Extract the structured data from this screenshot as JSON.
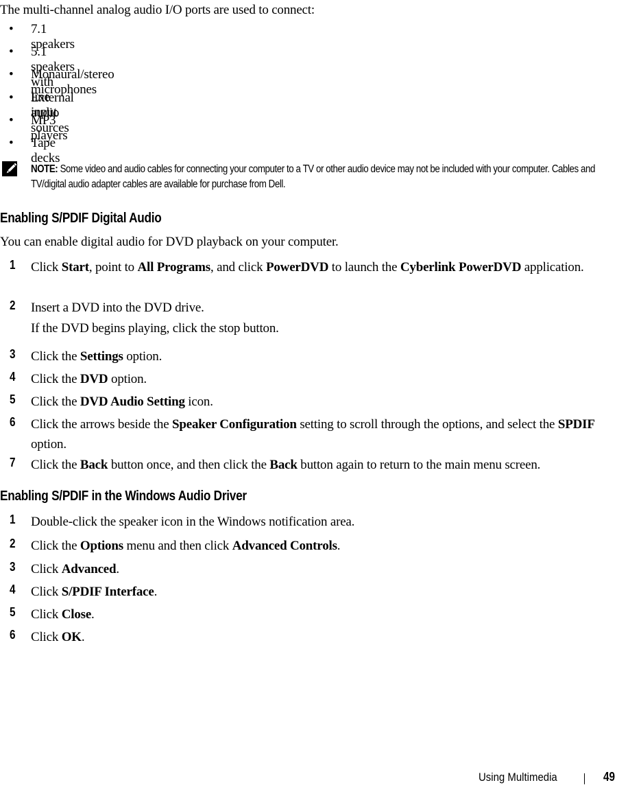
{
  "intro": "The multi-channel analog audio I/O ports are used to connect:",
  "bullets": [
    "7.1 speakers",
    "5.1 speakers with line input",
    "Monaural/stereo microphones",
    "External audio sources",
    "MP3 players",
    "Tape decks"
  ],
  "bullet_glyph": "•",
  "note": {
    "icon": "pencil-note-icon",
    "label": "NOTE:",
    "text": "Some video and audio cables for connecting your computer to a TV or other audio device may not be included with your computer. Cables and TV/digital audio adapter cables are available for purchase from Dell."
  },
  "section1": {
    "heading": "Enabling S/PDIF Digital Audio",
    "intro": "You can enable digital audio for DVD playback on your computer.",
    "steps": [
      {
        "num": "1",
        "parts": [
          [
            "",
            "Click "
          ],
          [
            "b",
            "Start"
          ],
          [
            "",
            ", point to "
          ],
          [
            "b",
            "All Programs"
          ],
          [
            "",
            ", and click "
          ],
          [
            "b",
            "PowerDVD"
          ],
          [
            "",
            " to launch the "
          ],
          [
            "b",
            "Cyberlink PowerDVD"
          ],
          [
            "",
            " application."
          ]
        ]
      },
      {
        "num": "2",
        "parts": [
          [
            "",
            "Insert a DVD into the DVD drive."
          ]
        ],
        "followup": "If the DVD begins playing, click the stop button."
      },
      {
        "num": "3",
        "parts": [
          [
            "",
            "Click the "
          ],
          [
            "b",
            "Settings"
          ],
          [
            "",
            " option."
          ]
        ]
      },
      {
        "num": "4",
        "parts": [
          [
            "",
            "Click the "
          ],
          [
            "b",
            "DVD"
          ],
          [
            "",
            " option."
          ]
        ]
      },
      {
        "num": "5",
        "parts": [
          [
            "",
            "Click the "
          ],
          [
            "b",
            "DVD Audio Setting"
          ],
          [
            "",
            " icon."
          ]
        ]
      },
      {
        "num": "6",
        "parts": [
          [
            "",
            "Click the arrows beside the "
          ],
          [
            "b",
            "Speaker Configuration"
          ],
          [
            "",
            " setting to scroll through the options, and select the "
          ],
          [
            "b",
            "SPDIF"
          ],
          [
            "",
            " option."
          ]
        ]
      },
      {
        "num": "7",
        "parts": [
          [
            "",
            "Click the "
          ],
          [
            "b",
            "Back"
          ],
          [
            "",
            " button once, and then click the "
          ],
          [
            "b",
            "Back"
          ],
          [
            "",
            " button again to return to the main menu screen."
          ]
        ]
      }
    ]
  },
  "section2": {
    "heading": "Enabling S/PDIF in the Windows Audio Driver",
    "steps": [
      {
        "num": "1",
        "parts": [
          [
            "",
            "Double-click the speaker icon in the Windows notification area."
          ]
        ]
      },
      {
        "num": "2",
        "parts": [
          [
            "",
            "Click the "
          ],
          [
            "b",
            "Options"
          ],
          [
            "",
            " menu and then click "
          ],
          [
            "b",
            "Advanced Controls"
          ],
          [
            "",
            "."
          ]
        ]
      },
      {
        "num": "3",
        "parts": [
          [
            "",
            "Click "
          ],
          [
            "b",
            "Advanced"
          ],
          [
            "",
            "."
          ]
        ]
      },
      {
        "num": "4",
        "parts": [
          [
            "",
            "Click "
          ],
          [
            "b",
            "S/PDIF Interface"
          ],
          [
            "",
            "."
          ]
        ]
      },
      {
        "num": "5",
        "parts": [
          [
            "",
            "Click "
          ],
          [
            "b",
            "Close"
          ],
          [
            "",
            "."
          ]
        ]
      },
      {
        "num": "6",
        "parts": [
          [
            "",
            "Click "
          ],
          [
            "b",
            "OK"
          ],
          [
            "",
            "."
          ]
        ]
      }
    ]
  },
  "footer": {
    "section_title": "Using Multimedia",
    "page_number": "49"
  }
}
